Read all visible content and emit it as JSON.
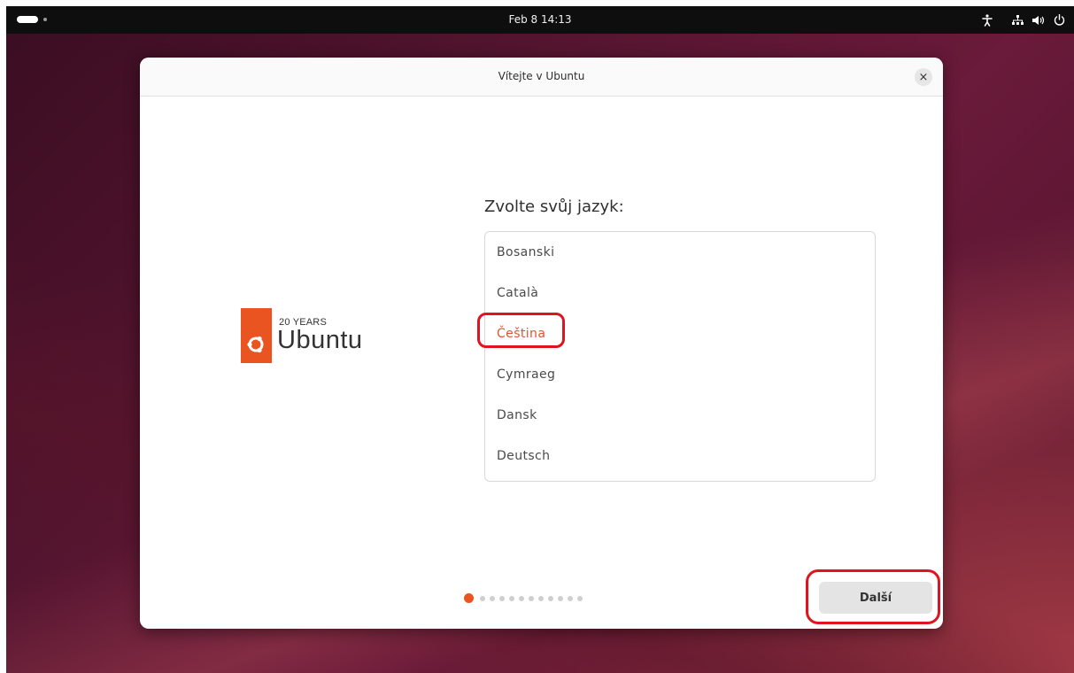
{
  "topbar": {
    "clock": "Feb 8  14:13",
    "icons": [
      "activities-indicator",
      "accessibility-icon",
      "network-icon",
      "volume-icon",
      "power-icon"
    ]
  },
  "dialog": {
    "title": "Vítejte v Ubuntu",
    "close_label": "×",
    "logo": {
      "years": "20 YEARS",
      "wordmark": "Ubuntu",
      "brand_color": "#e95420"
    },
    "prompt": "Zvolte svůj jazyk:",
    "languages": [
      {
        "label": "Bosanski",
        "selected": false
      },
      {
        "label": "Català",
        "selected": false
      },
      {
        "label": "Čeština",
        "selected": true
      },
      {
        "label": "Cymraeg",
        "selected": false
      },
      {
        "label": "Dansk",
        "selected": false
      },
      {
        "label": "Deutsch",
        "selected": false
      }
    ],
    "pager": {
      "total": 12,
      "current": 1
    },
    "next_label": "Další"
  },
  "colors": {
    "accent": "#e95420",
    "annotation": "#e0141e"
  }
}
